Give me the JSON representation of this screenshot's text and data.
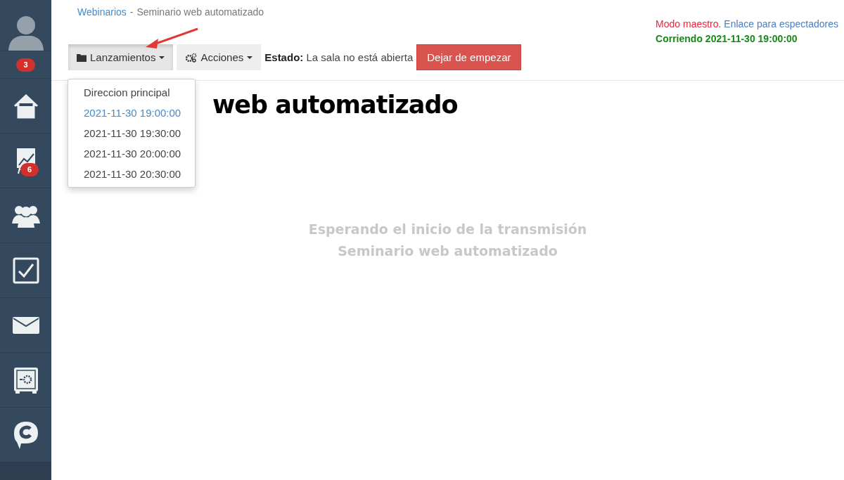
{
  "sidebar": {
    "top_badge": "3",
    "items": [
      {
        "kind": "home"
      },
      {
        "kind": "chart",
        "badge": "6"
      },
      {
        "kind": "users"
      },
      {
        "kind": "tasks"
      },
      {
        "kind": "mail"
      },
      {
        "kind": "safe"
      },
      {
        "kind": "chat"
      }
    ]
  },
  "breadcrumb": {
    "link": "Webinarios",
    "separator": "-",
    "current": "Seminario web automatizado"
  },
  "info": {
    "mode": "Modo maestro.",
    "viewer_link": "Enlace para espectadores",
    "running": "Corriendo 2021-11-30 19:00:00"
  },
  "toolbar": {
    "launches": {
      "label": "Lanzamientos",
      "expanded": true
    },
    "actions": {
      "label": "Acciones"
    },
    "status_label": "Estado:",
    "status_value": "La sala no está abierta",
    "stop_button": "Dejar de empezar"
  },
  "menu": [
    {
      "label": "Direccion principal",
      "selected": false
    },
    {
      "label": "2021-11-30 19:00:00",
      "selected": true
    },
    {
      "label": "2021-11-30 19:30:00",
      "selected": false
    },
    {
      "label": "2021-11-30 20:00:00",
      "selected": false
    },
    {
      "label": "2021-11-30 20:30:00",
      "selected": false
    }
  ],
  "heading": "web automatizado",
  "waiting": [
    "Esperando el inicio de la transmisión",
    "Seminario web automatizado"
  ]
}
